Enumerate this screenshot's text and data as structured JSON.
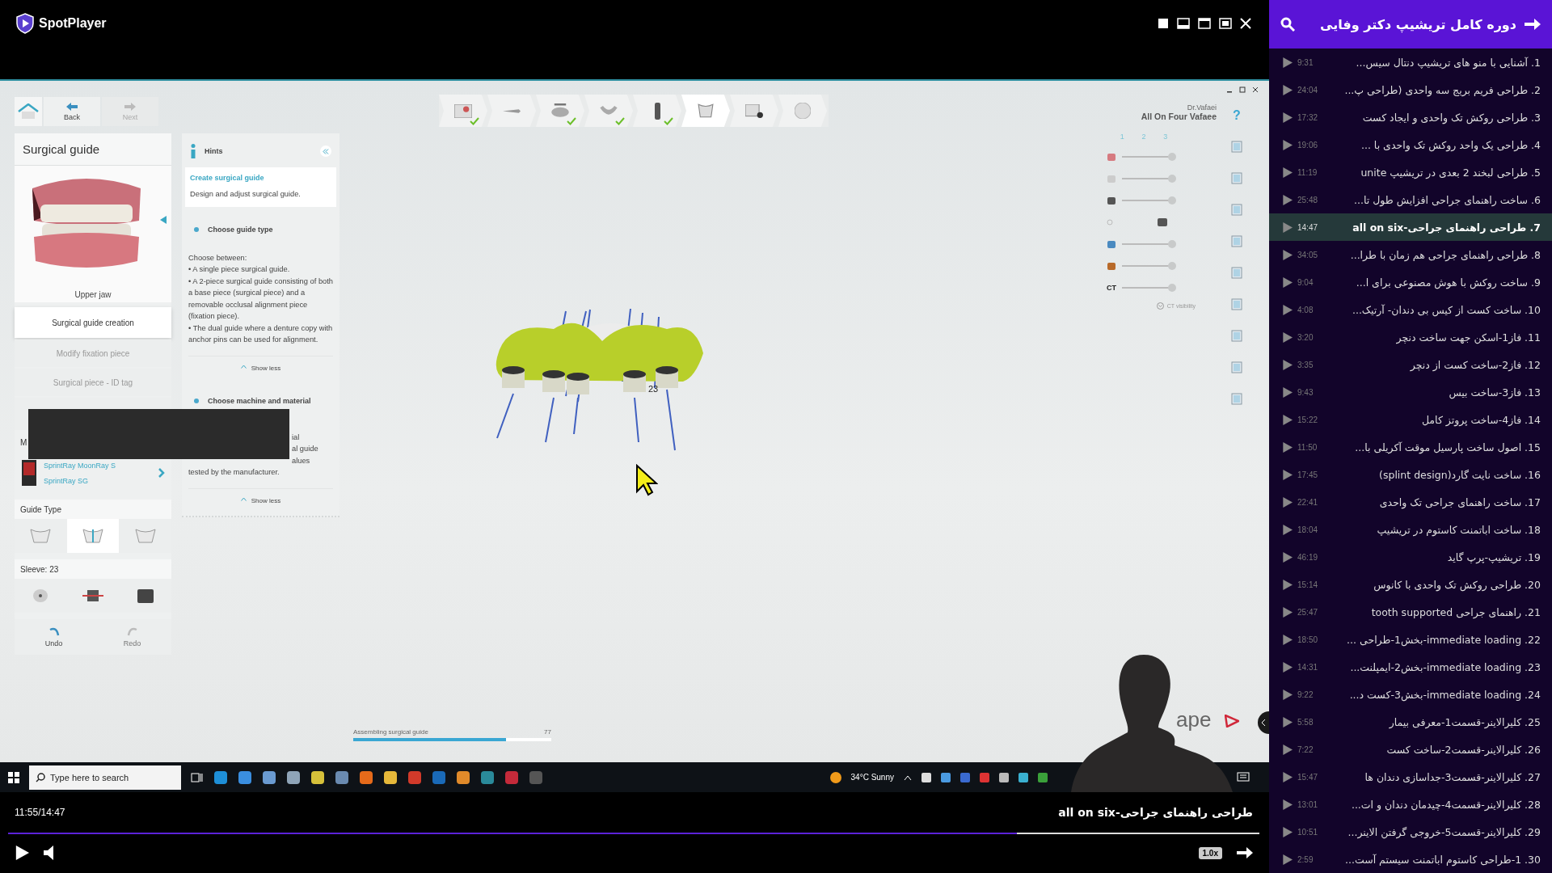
{
  "player": {
    "app_name": "SpotPlayer",
    "time": "11:55/14:47",
    "title": "طراحی راهنمای جراحی-all on six",
    "progress": {
      "level": 0.806
    },
    "speed": "1.0x"
  },
  "video_frame": {
    "nav": {
      "back": {
        "label": "Back",
        "disabled": false
      },
      "next": {
        "label": "Next",
        "disabled": true
      }
    },
    "panel": {
      "title": "Surgical guide",
      "jaw_caption": "Upper jaw",
      "steps": [
        {
          "label": "Surgical guide creation",
          "selected": true
        },
        {
          "label": "Modify fixation piece",
          "selected": false
        },
        {
          "label": "Surgical piece - ID tag",
          "selected": false
        }
      ],
      "section_label_fragment": "M",
      "machine": [
        "SprintRay MoonRay S",
        "SprintRay SG"
      ],
      "guide_type": {
        "label": "Guide Type",
        "options": [
          {
            "selected": false
          },
          {
            "selected": true
          },
          {
            "selected": false
          }
        ]
      },
      "sleeve_label": "Sleeve: 23",
      "history": {
        "undo": {
          "label": "Undo",
          "disabled": false
        },
        "redo": {
          "label": "Redo",
          "disabled": true
        }
      }
    },
    "hints": {
      "title": "Hints",
      "card_title": "Create surgical guide",
      "card_text": "Design and adjust surgical guide.",
      "sections": [
        {
          "title": "Choose guide type",
          "lines": [
            "Choose between:",
            "• A single piece surgical guide.",
            "• A 2-piece surgical guide consisting of both a base piece (surgical piece) and a removable occlusal alignment piece (fixation piece).",
            "• The dual guide where a denture copy with anchor pins can be used for alignment."
          ],
          "toggle": "Show less"
        },
        {
          "title": "Choose machine and material",
          "fragments": [
            "ial",
            "al guide",
            "alues"
          ],
          "lines": [
            "tested by the manufacturer."
          ],
          "toggle": "Show less"
        }
      ]
    },
    "workflow_steps": [
      {
        "checked": true,
        "selected": false
      },
      {
        "checked": false,
        "selected": false
      },
      {
        "checked": true,
        "selected": false
      },
      {
        "checked": true,
        "selected": false
      },
      {
        "checked": true,
        "selected": false
      },
      {
        "checked": false,
        "selected": true
      },
      {
        "checked": false,
        "selected": false
      },
      {
        "checked": false,
        "selected": false
      }
    ],
    "model": {
      "tooth_label": "23"
    },
    "case": {
      "doctor": "Dr.Vafaei",
      "name": "All On Four Vafaee"
    },
    "help": "?",
    "visibility": {
      "columns": {
        "first": "1",
        "second": "2",
        "third": "3"
      },
      "rows": [
        {
          "kind": "slider",
          "level": 1
        },
        {
          "kind": "slider",
          "level": 1
        },
        {
          "kind": "slider",
          "level": 1
        },
        {
          "kind": "switch"
        },
        {
          "kind": "slider",
          "level": 1
        },
        {
          "kind": "slider",
          "level": 1
        },
        {
          "kind": "slider",
          "label": "CT",
          "level": 1
        }
      ],
      "ct_toggle": "CT visibility"
    },
    "progress": {
      "label": "Assembling surgical guide",
      "value": "77",
      "level": 0.77
    },
    "logo_fragment": "ape",
    "taskbar": {
      "placeholder": "Type here to search",
      "weather": "34°C Sunny"
    }
  },
  "playlist": {
    "title": "دوره کامل تریشیپ دکتر وفایی",
    "items": [
      {
        "title": "1. آشنایی با منو های تریشیپ دنتال سیس...",
        "duration": "9:31",
        "selected": false
      },
      {
        "title": "2. طراحی فریم بریج سه واحدی (طراحی پ...",
        "duration": "24:04",
        "selected": false
      },
      {
        "title": "3. طراحی روکش تک واحدی و ایجاد کست",
        "duration": "17:32",
        "selected": false
      },
      {
        "title": "4. طراحی یک واحد روکش تک واحدی با ...",
        "duration": "19:06",
        "selected": false
      },
      {
        "title": "5. طراحی لبخند 2 بعدی در تریشیپ unite",
        "duration": "11:19",
        "selected": false
      },
      {
        "title": "6. ساخت راهنمای جراحی افزایش طول تا...",
        "duration": "25:48",
        "selected": false
      },
      {
        "title": "7. طراحی راهنمای جراحی-all on six",
        "duration": "14:47",
        "selected": true
      },
      {
        "title": "8. طراحی راهنمای جراحی هم زمان با طرا...",
        "duration": "34:05",
        "selected": false
      },
      {
        "title": "9. ساخت روکش  با هوش مصنوعی برای ا...",
        "duration": "9:04",
        "selected": false
      },
      {
        "title": "10. ساخت کست از کیس بی دندان- آرتیک...",
        "duration": "4:08",
        "selected": false
      },
      {
        "title": "11. فاز1-اسکن جهت ساخت دنچر",
        "duration": "3:20",
        "selected": false
      },
      {
        "title": "12. فاز2-ساخت کست از دنچر",
        "duration": "3:35",
        "selected": false
      },
      {
        "title": "13. فاز3-ساخت بیس",
        "duration": "9:43",
        "selected": false
      },
      {
        "title": "14. فاز4-ساخت پروتز کامل",
        "duration": "15:22",
        "selected": false
      },
      {
        "title": "15. اصول ساخت پارسیل موقت آکریلی با...",
        "duration": "11:50",
        "selected": false
      },
      {
        "title": "16. ساخت نایت گارد(splint design)",
        "duration": "17:45",
        "selected": false
      },
      {
        "title": "17. ساخت راهنمای جراحی تک واحدی",
        "duration": "22:41",
        "selected": false
      },
      {
        "title": "18. ساخت اباتمنت کاستوم در تریشیپ",
        "duration": "18:04",
        "selected": false
      },
      {
        "title": "19. تریشیپ-پرپ گاید",
        "duration": "46:19",
        "selected": false
      },
      {
        "title": "20. طراحی روکش تک واحدی با کانوس",
        "duration": "15:14",
        "selected": false
      },
      {
        "title": "21. راهنمای جراحی  tooth supported",
        "duration": "25:47",
        "selected": false
      },
      {
        "title": "22. immediate loading-بخش1-طراحی ...",
        "duration": "18:50",
        "selected": false
      },
      {
        "title": "23. immediate loading-بخش2-ایمپلنت...",
        "duration": "14:31",
        "selected": false
      },
      {
        "title": "24. immediate loading-بخش3-کست د...",
        "duration": "9:22",
        "selected": false
      },
      {
        "title": "25. کلیرالاینر-قسمت1-معرفی بیمار",
        "duration": "5:58",
        "selected": false
      },
      {
        "title": "26. کلیرالاینر-قسمت2-ساخت کست",
        "duration": "7:22",
        "selected": false
      },
      {
        "title": "27. کلیرالاینر-قسمت3-جداسازی دندان ها",
        "duration": "15:47",
        "selected": false
      },
      {
        "title": "28. کلیرالاینر-قسمت4-چیدمان دندان و ات...",
        "duration": "13:01",
        "selected": false
      },
      {
        "title": "29. کلیرالاینر-قسمت5-خروجی گرفتن الاینر...",
        "duration": "10:51",
        "selected": false
      },
      {
        "title": "30. 1-طراحی کاستوم اباتمنت سیستم آست...",
        "duration": "2:59",
        "selected": false
      }
    ]
  }
}
